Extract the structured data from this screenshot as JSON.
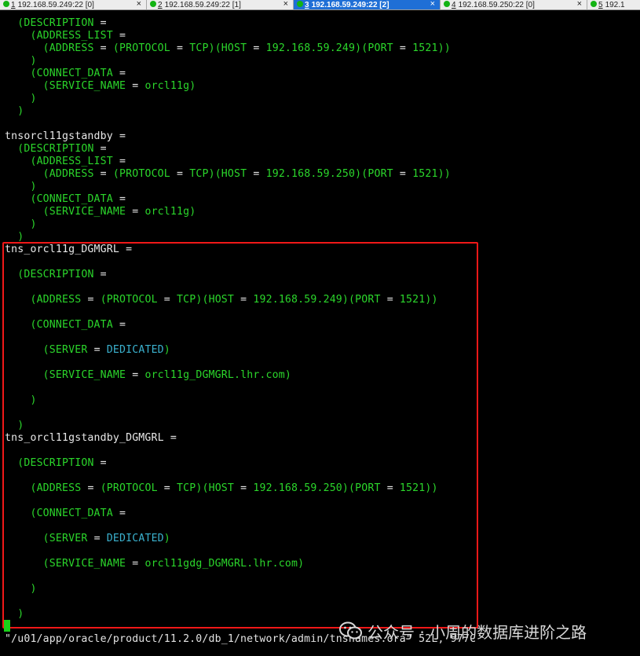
{
  "tabs": [
    {
      "number": "1",
      "host": "192.168.59.249:22 [0]",
      "active": false
    },
    {
      "number": "2",
      "host": "192.168.59.249:22 [1]",
      "active": false
    },
    {
      "number": "3",
      "host": "192.168.59.249:22 [2]",
      "active": true
    },
    {
      "number": "4",
      "host": "192.168.59.250:22 [0]",
      "active": false
    },
    {
      "number": "5",
      "host": "192.1",
      "active": false
    }
  ],
  "tab_close_glyph": "×",
  "colors": {
    "keyword": "#2bd62b",
    "value": "#3bb2cf",
    "plain": "#e8e8e8",
    "highlight_box": "#f01818",
    "active_tab": "#1f6fd6",
    "status_dot": "#13b313"
  },
  "terminal": {
    "lines": [
      [
        [
          "p",
          "  "
        ],
        [
          "k",
          "(DESCRIPTION"
        ],
        [
          "p",
          " ="
        ]
      ],
      [
        [
          "p",
          "    "
        ],
        [
          "k",
          "(ADDRESS_LIST"
        ],
        [
          "p",
          " ="
        ]
      ],
      [
        [
          "p",
          "      "
        ],
        [
          "k",
          "(ADDRESS"
        ],
        [
          "p",
          " = "
        ],
        [
          "k",
          "(PROTOCOL"
        ],
        [
          "p",
          " = "
        ],
        [
          "k",
          "TCP)(HOST"
        ],
        [
          "p",
          " = "
        ],
        [
          "k",
          "192.168.59.249)(PORT"
        ],
        [
          "p",
          " = "
        ],
        [
          "k",
          "1521))"
        ]
      ],
      [
        [
          "p",
          "    "
        ],
        [
          "k",
          ")"
        ]
      ],
      [
        [
          "p",
          "    "
        ],
        [
          "k",
          "(CONNECT_DATA"
        ],
        [
          "p",
          " ="
        ]
      ],
      [
        [
          "p",
          "      "
        ],
        [
          "k",
          "(SERVICE_NAME"
        ],
        [
          "p",
          " = "
        ],
        [
          "k",
          "orcl11g)"
        ]
      ],
      [
        [
          "p",
          "    "
        ],
        [
          "k",
          ")"
        ]
      ],
      [
        [
          "p",
          "  "
        ],
        [
          "k",
          ")"
        ]
      ],
      [],
      [
        [
          "p",
          "tnsorcl11gstandby ="
        ]
      ],
      [
        [
          "p",
          "  "
        ],
        [
          "k",
          "(DESCRIPTION"
        ],
        [
          "p",
          " ="
        ]
      ],
      [
        [
          "p",
          "    "
        ],
        [
          "k",
          "(ADDRESS_LIST"
        ],
        [
          "p",
          " ="
        ]
      ],
      [
        [
          "p",
          "      "
        ],
        [
          "k",
          "(ADDRESS"
        ],
        [
          "p",
          " = "
        ],
        [
          "k",
          "(PROTOCOL"
        ],
        [
          "p",
          " = "
        ],
        [
          "k",
          "TCP)(HOST"
        ],
        [
          "p",
          " = "
        ],
        [
          "k",
          "192.168.59.250)(PORT"
        ],
        [
          "p",
          " = "
        ],
        [
          "k",
          "1521))"
        ]
      ],
      [
        [
          "p",
          "    "
        ],
        [
          "k",
          ")"
        ]
      ],
      [
        [
          "p",
          "    "
        ],
        [
          "k",
          "(CONNECT_DATA"
        ],
        [
          "p",
          " ="
        ]
      ],
      [
        [
          "p",
          "      "
        ],
        [
          "k",
          "(SERVICE_NAME"
        ],
        [
          "p",
          " = "
        ],
        [
          "k",
          "orcl11g)"
        ]
      ],
      [
        [
          "p",
          "    "
        ],
        [
          "k",
          ")"
        ]
      ],
      [
        [
          "p",
          "  "
        ],
        [
          "k",
          ")"
        ]
      ],
      [
        [
          "p",
          "tns_orcl11g_DGMGRL ="
        ]
      ],
      [],
      [
        [
          "p",
          "  "
        ],
        [
          "k",
          "(DESCRIPTION"
        ],
        [
          "p",
          " ="
        ]
      ],
      [],
      [
        [
          "p",
          "    "
        ],
        [
          "k",
          "(ADDRESS"
        ],
        [
          "p",
          " = "
        ],
        [
          "k",
          "(PROTOCOL"
        ],
        [
          "p",
          " = "
        ],
        [
          "k",
          "TCP)(HOST"
        ],
        [
          "p",
          " = "
        ],
        [
          "k",
          "192.168.59.249)(PORT"
        ],
        [
          "p",
          " = "
        ],
        [
          "k",
          "1521))"
        ]
      ],
      [],
      [
        [
          "p",
          "    "
        ],
        [
          "k",
          "(CONNECT_DATA"
        ],
        [
          "p",
          " ="
        ]
      ],
      [],
      [
        [
          "p",
          "      "
        ],
        [
          "k",
          "(SERVER"
        ],
        [
          "p",
          " = "
        ],
        [
          "v",
          "DEDICATED"
        ],
        [
          "k",
          ")"
        ]
      ],
      [],
      [
        [
          "p",
          "      "
        ],
        [
          "k",
          "(SERVICE_NAME"
        ],
        [
          "p",
          " = "
        ],
        [
          "k",
          "orcl11g_DGMGRL.lhr.com)"
        ]
      ],
      [],
      [
        [
          "p",
          "    "
        ],
        [
          "k",
          ")"
        ]
      ],
      [],
      [
        [
          "p",
          "  "
        ],
        [
          "k",
          ")"
        ]
      ],
      [
        [
          "p",
          "tns_orcl11gstandby_DGMGRL ="
        ]
      ],
      [],
      [
        [
          "p",
          "  "
        ],
        [
          "k",
          "(DESCRIPTION"
        ],
        [
          "p",
          " ="
        ]
      ],
      [],
      [
        [
          "p",
          "    "
        ],
        [
          "k",
          "(ADDRESS"
        ],
        [
          "p",
          " = "
        ],
        [
          "k",
          "(PROTOCOL"
        ],
        [
          "p",
          " = "
        ],
        [
          "k",
          "TCP)(HOST"
        ],
        [
          "p",
          " = "
        ],
        [
          "k",
          "192.168.59.250)(PORT"
        ],
        [
          "p",
          " = "
        ],
        [
          "k",
          "1521))"
        ]
      ],
      [],
      [
        [
          "p",
          "    "
        ],
        [
          "k",
          "(CONNECT_DATA"
        ],
        [
          "p",
          " ="
        ]
      ],
      [],
      [
        [
          "p",
          "      "
        ],
        [
          "k",
          "(SERVER"
        ],
        [
          "p",
          " = "
        ],
        [
          "v",
          "DEDICATED"
        ],
        [
          "k",
          ")"
        ]
      ],
      [],
      [
        [
          "p",
          "      "
        ],
        [
          "k",
          "(SERVICE_NAME"
        ],
        [
          "p",
          " = "
        ],
        [
          "k",
          "orcl11gdg_DGMGRL.lhr.com)"
        ]
      ],
      [],
      [
        [
          "p",
          "    "
        ],
        [
          "k",
          ")"
        ]
      ],
      [],
      [
        [
          "p",
          "  "
        ],
        [
          "k",
          ")"
        ]
      ]
    ],
    "status_line": "\"/u01/app/oracle/product/11.2.0/db_1/network/admin/tnsnames.ora\" 52L, 977C"
  },
  "watermark": {
    "icon": "wechat-icon",
    "text": "公众号 · 小周的数据库进阶之路"
  }
}
